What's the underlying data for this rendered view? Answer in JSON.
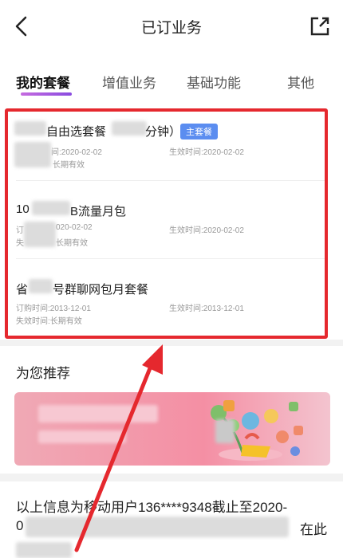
{
  "header": {
    "title": "已订业务"
  },
  "tabs": [
    {
      "label": "我的套餐",
      "active": true
    },
    {
      "label": "增值业务",
      "active": false
    },
    {
      "label": "基础功能",
      "active": false
    },
    {
      "label": "其他",
      "active": false
    }
  ],
  "plans": [
    {
      "name": "自由选套餐",
      "name_suffix": "分钟）",
      "badge": "主套餐",
      "order_time": "间:2020-02-02",
      "effective_time": "生效时间:2020-02-02",
      "expire": "长期有效"
    },
    {
      "name_prefix": "10",
      "name": "B流量月包",
      "order_time": "020-02-02",
      "order_prefix": "订",
      "effective_time": "生效时间:2020-02-02",
      "expire_prefix": "失",
      "expire": "长期有效"
    },
    {
      "name_prefix": "省",
      "name": "号群聊网包月套餐",
      "order_time": "订购时间:2013-12-01",
      "effective_time": "生效时间:2013-12-01",
      "expire": "失效时间:长期有效"
    }
  ],
  "recommend": {
    "title": "为您推荐"
  },
  "footer": {
    "text_line1": "以上信息为移动用户136****9348截止至2020-",
    "text_line2": "0",
    "text_line2_end": "在此"
  },
  "colors": {
    "accent": "#8a4ce0",
    "highlight": "#e5282e",
    "badge": "#5b8df0"
  }
}
